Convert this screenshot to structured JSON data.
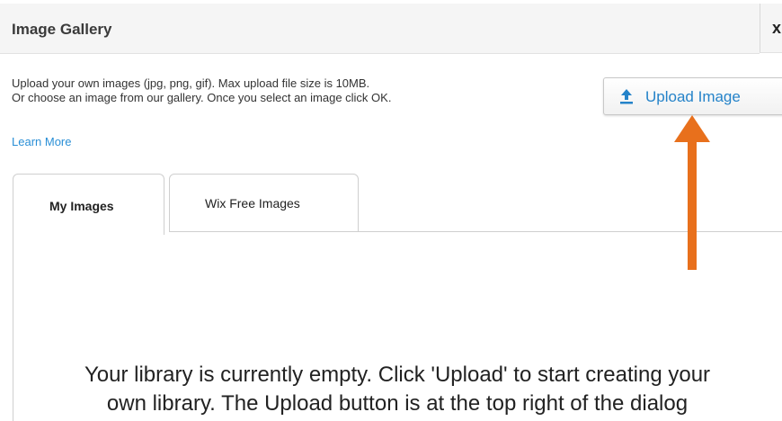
{
  "dialog": {
    "title": "Image Gallery",
    "close_glyph": "x",
    "intro_line1": "Upload your own images (jpg, png, gif). Max upload file size is 10MB.",
    "intro_line2": "Or choose an image from our gallery. Once you select an image click OK.",
    "upload_button_label": "Upload Image",
    "upload_icon": "upload-icon",
    "learn_more": "Learn More",
    "tabs": [
      {
        "label": "My Images",
        "selected": true
      },
      {
        "label": "Wix Free Images",
        "selected": false
      }
    ],
    "empty_message_line1": "Your library is currently empty. Click 'Upload' to start creating your",
    "empty_message_line2": "own library. The Upload button is at the top right of the dialog"
  },
  "colors": {
    "accent_blue": "#2583c9",
    "annotation_arrow": "#e8701c"
  }
}
